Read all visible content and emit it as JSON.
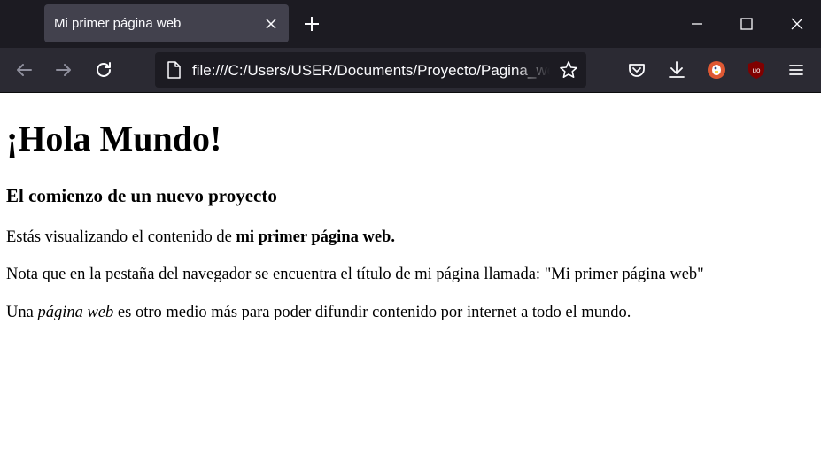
{
  "browser": {
    "tab_title": "Mi primer página web",
    "address": "file:///C:/Users/USER/Documents/Proyecto/Pagina_web/index.html",
    "icons": [
      "close-icon",
      "plus-icon",
      "minimize-icon",
      "maximize-icon",
      "window-close-icon",
      "back-arrow-icon",
      "forward-arrow-icon",
      "reload-icon",
      "page-icon",
      "star-icon",
      "pocket-icon",
      "download-icon",
      "duckduckgo-icon",
      "ublock-icon",
      "menu-icon"
    ],
    "colors": {
      "titlebar": "#1c1b22",
      "tab": "#42414d",
      "toolbar": "#2b2a33",
      "urlbar": "#1c1b22",
      "duckduckgo": "#de5833",
      "ublock": "#800000"
    }
  },
  "page": {
    "heading": "¡Hola Mundo!",
    "subheading": "El comienzo de un nuevo proyecto",
    "p1_before": "Estás visualizando el contenido de ",
    "p1_bold": "mi primer página web.",
    "p2": "Nota que en la pestaña del navegador se encuentra el título de mi página llamada: \"Mi primer página web\"",
    "p3_before": "Una ",
    "p3_italic": "página web",
    "p3_after": " es otro medio más para poder difundir contenido por internet a todo el mundo."
  }
}
